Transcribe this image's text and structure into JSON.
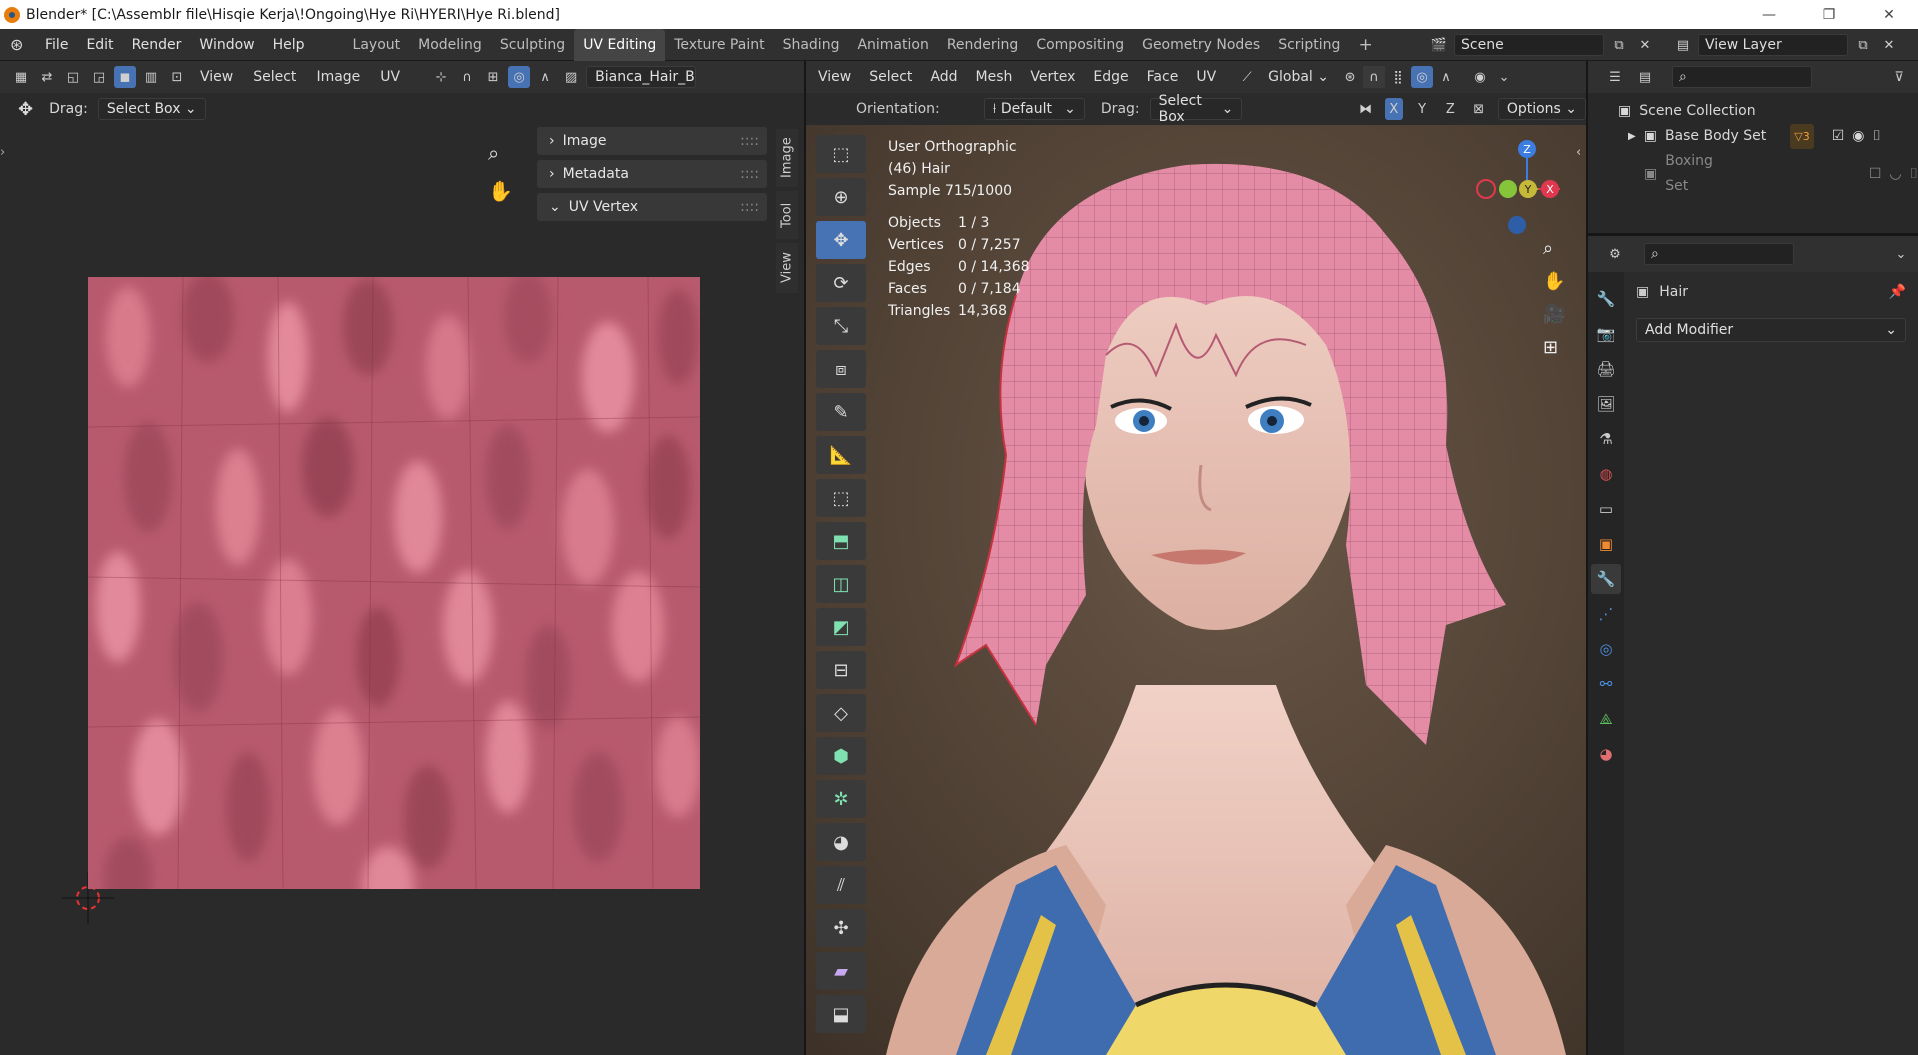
{
  "window": {
    "title": "Blender* [C:\\Assemblr file\\Hisqie Kerja\\!Ongoing\\Hye Ri\\HYERI\\Hye Ri.blend]",
    "controls": [
      "—",
      "❐",
      "✕"
    ]
  },
  "menubar": {
    "menus": [
      "File",
      "Edit",
      "Render",
      "Window",
      "Help"
    ],
    "workspaces": [
      "Layout",
      "Modeling",
      "Sculpting",
      "UV Editing",
      "Texture Paint",
      "Shading",
      "Animation",
      "Rendering",
      "Compositing",
      "Geometry Nodes",
      "Scripting"
    ],
    "active_workspace": "UV Editing",
    "add_workspace": "+",
    "scene_name": "Scene",
    "view_layer": "View Layer"
  },
  "uv_editor": {
    "header_menus": [
      "View",
      "Select",
      "Image",
      "UV"
    ],
    "image_name": "Bianca_Hair_Bas",
    "drag_label": "Drag:",
    "drag_value": "Select Box",
    "panels": [
      {
        "label": "Image",
        "expanded": false
      },
      {
        "label": "Metadata",
        "expanded": false
      },
      {
        "label": "UV Vertex",
        "expanded": true
      }
    ],
    "side_tabs": [
      "Image",
      "Tool",
      "View"
    ]
  },
  "viewport": {
    "header_menus": [
      "View",
      "Select",
      "Add",
      "Mesh",
      "Vertex",
      "Edge",
      "Face",
      "UV"
    ],
    "transform_orientation": "Global",
    "orientation_label": "Orientation:",
    "orientation_value": "Default",
    "drag_label": "Drag:",
    "drag_value": "Select Box",
    "axes": [
      "X",
      "Y",
      "Z"
    ],
    "options_label": "Options",
    "view_name": "User Orthographic",
    "object_info": "(46) Hair",
    "sample": "Sample 715/1000",
    "stats": [
      {
        "label": "Objects",
        "value": "1 / 3"
      },
      {
        "label": "Vertices",
        "value": "0 / 7,257"
      },
      {
        "label": "Edges",
        "value": "0 / 14,368"
      },
      {
        "label": "Faces",
        "value": "0 / 7,184"
      },
      {
        "label": "Triangles",
        "value": "14,368"
      }
    ],
    "gizmo": {
      "z": "Z",
      "y": "Y",
      "x": "X"
    }
  },
  "outliner": {
    "root": "Scene Collection",
    "items": [
      {
        "label": "Base Body Set",
        "badge": "3"
      },
      {
        "label": "Boxing Set"
      }
    ]
  },
  "properties": {
    "object_name": "Hair",
    "add_modifier": "Add Modifier"
  }
}
